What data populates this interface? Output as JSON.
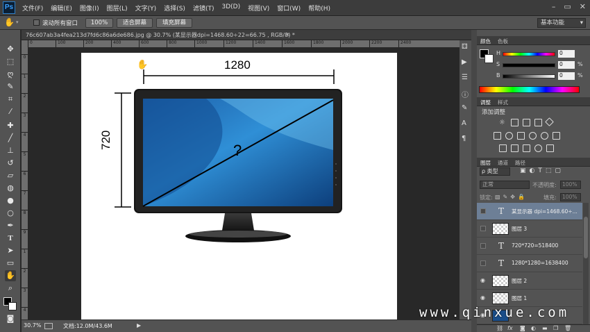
{
  "app": {
    "logo": "Ps"
  },
  "menu": [
    "文件(F)",
    "编辑(E)",
    "图像(I)",
    "图层(L)",
    "文字(Y)",
    "选择(S)",
    "滤镜(T)",
    "3D(D)",
    "视图(V)",
    "窗口(W)",
    "帮助(H)"
  ],
  "window_controls": {
    "minimize": "–",
    "restore": "▭",
    "close": "✕"
  },
  "options": {
    "scroll_all_label": "滚动所有窗口",
    "zoom_button": "100%",
    "fit_screen_button": "适合屏幕",
    "fill_screen_button": "填充屏幕",
    "workspace": "基本功能"
  },
  "document": {
    "tab_title": "76c607ab3a4fea213d7fd6c86a6de686.jpg @ 30.7% (某显示器dpi=1468.60÷22=66.75 , RGB/8) *",
    "zoom": "30.7%",
    "doc_size": "文档:12.0M/43.6M"
  },
  "ruler": {
    "top": [
      "0",
      "100",
      "200",
      "400",
      "600",
      "800",
      "1000",
      "1200",
      "1400",
      "1600",
      "1800",
      "2000",
      "2200",
      "2400"
    ],
    "left": [
      "0",
      "1",
      "2",
      "3",
      "4",
      "5",
      "6",
      "7",
      "8",
      "9",
      "1",
      "2",
      "3",
      "4"
    ]
  },
  "canvas": {
    "width_label": "1280",
    "height_label": "720",
    "question": "?"
  },
  "color_panel": {
    "tabs": [
      "颜色",
      "色板"
    ],
    "channels": [
      {
        "label": "H",
        "value": "0",
        "unit": ""
      },
      {
        "label": "S",
        "value": "0",
        "unit": "%"
      },
      {
        "label": "B",
        "value": "0",
        "unit": "%"
      }
    ]
  },
  "adjust_panel": {
    "tabs": [
      "调整",
      "样式"
    ],
    "heading": "添加调整"
  },
  "layers_panel": {
    "tabs": [
      "图层",
      "通道",
      "路径"
    ],
    "filter": "ρ 类型",
    "blend": "正常",
    "opacity_label": "不透明度:",
    "opacity_value": "100%",
    "lock_label": "锁定:",
    "fill_label": "填充:",
    "fill_value": "100%",
    "layers": [
      {
        "name": "某显示器 dpi=1468.60÷...",
        "type": "text",
        "visible": false,
        "selected": true
      },
      {
        "name": "图层 3",
        "type": "pixel",
        "visible": false,
        "selected": false
      },
      {
        "name": "720*720=518400",
        "type": "text",
        "visible": false,
        "selected": false
      },
      {
        "name": "1280*1280=1638400",
        "type": "text",
        "visible": false,
        "selected": false
      },
      {
        "name": "图层 2",
        "type": "pixel",
        "visible": true,
        "selected": false
      },
      {
        "name": "图层 1",
        "type": "pixel",
        "visible": true,
        "selected": false
      }
    ],
    "bottom_icons": [
      "link-icon",
      "fx-icon",
      "mask-icon",
      "adjustment-icon",
      "folder-icon",
      "new-layer-icon",
      "trash-icon"
    ]
  },
  "watermark": "www.qinxue.com"
}
